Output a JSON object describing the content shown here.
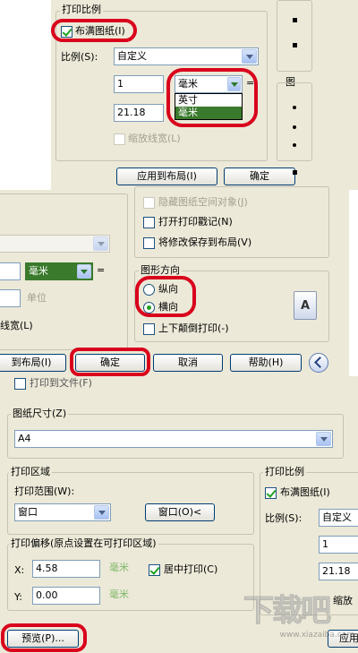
{
  "p1": {
    "group_title": "打印比例",
    "fit_paper": "布满图纸(I)",
    "scale_label": "比例(S):",
    "scale_value": "自定义",
    "value_top": "1",
    "unit_value": "毫米",
    "unit_options": [
      "英寸",
      "毫米"
    ],
    "value_bottom": "21.18",
    "eq": "=",
    "scale_lineweights": "缩放线宽(L)",
    "apply_button": "应用到布局(I)",
    "ok_button": "确定",
    "side_label": "图"
  },
  "p2": {
    "hide_objects": "隐藏图纸空间对象(J)",
    "plot_stamp": "打开打印戳记(N)",
    "save_layout": "将修改保存到布局(V)",
    "unit_value": "毫米",
    "eq": "=",
    "units_label": "单位",
    "lineweights": "线宽(L)",
    "orientation_title": "图形方向",
    "portrait": "纵向",
    "landscape": "横向",
    "upside_down": "上下颠倒打印(-)",
    "apply_button": "到布局(I)",
    "ok_button": "确定",
    "cancel_button": "取消",
    "help_button": "帮助(H)",
    "orientation_icon_letter": "A"
  },
  "p3": {
    "print_to_file": "打印到文件(F)",
    "paper_size_title": "图纸尺寸(Z)",
    "paper_size": "A4",
    "plot_area_title": "打印区域",
    "plot_range_label": "打印范围(W):",
    "plot_range": "窗口",
    "window_button": "窗口(O)<",
    "offset_title": "打印偏移(原点设置在可打印区域)",
    "x_label": "X:",
    "x_value": "4.58",
    "y_label": "Y:",
    "y_value": "0.00",
    "unit": "毫米",
    "center_plot": "居中打印(C)",
    "scale_title": "打印比例",
    "fit_paper": "布满图纸(I)",
    "scale_label": "比例(S):",
    "scale_value": "自定义",
    "value_top": "1",
    "value_bottom": "21.18",
    "eq": "=",
    "lineweights_short": "缩放",
    "preview_button": "预览(P)...",
    "apply_button": "应用"
  },
  "watermark": {
    "logo_text": "下载吧",
    "url": "www.xiazaiba.com"
  }
}
